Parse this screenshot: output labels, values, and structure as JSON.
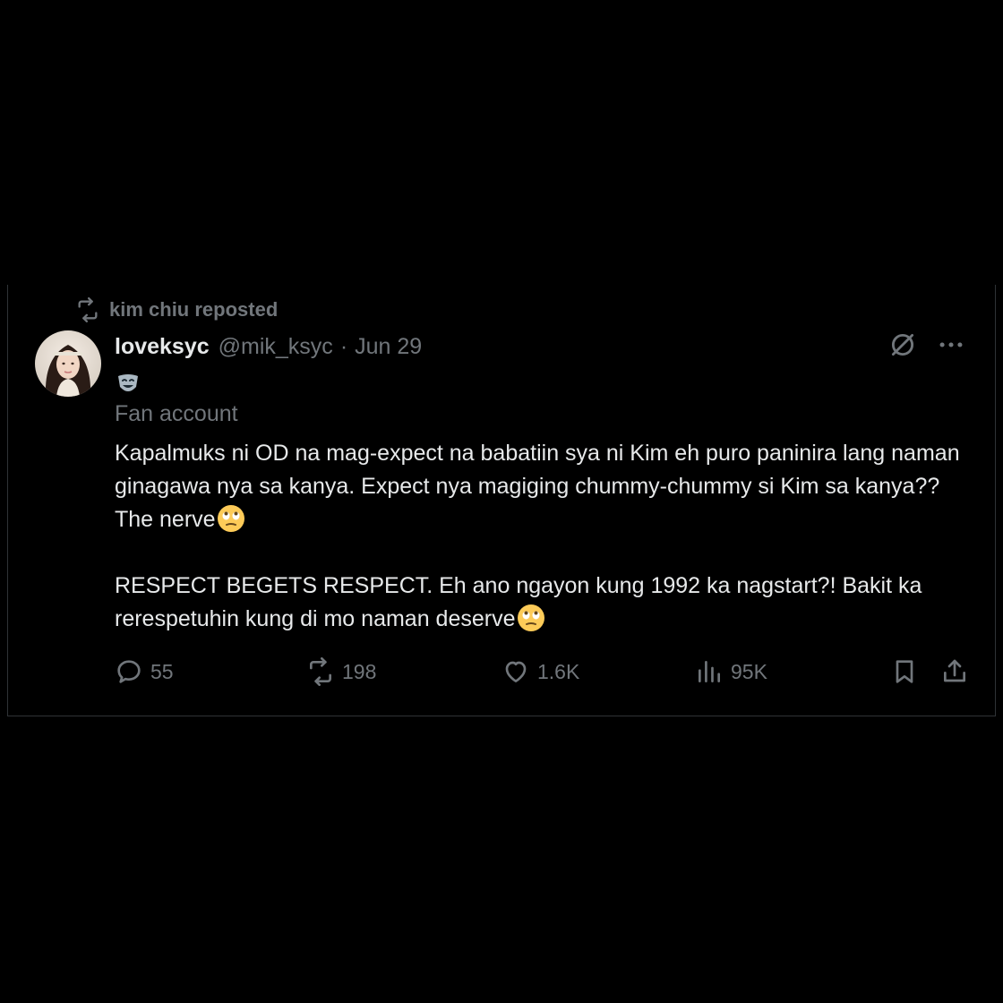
{
  "repost": {
    "text": "kim chiu reposted",
    "icon": "repost-icon"
  },
  "author": {
    "display_name": "loveksyc",
    "handle": "@mik_ksyc",
    "separator": "·",
    "date": "Jun 29",
    "badge_emoji": "performing-arts-mask-emoji",
    "label": "Fan account"
  },
  "tweet": {
    "paragraph1": "Kapalmuks ni OD na mag-expect na babatiin sya ni Kim eh puro paninira lang naman ginagawa nya sa kanya. Expect nya magiging chummy-chummy si Kim sa kanya?? The nerve",
    "paragraph2": "RESPECT BEGETS RESPECT. Eh ano ngayon kung 1992 ka nagstart?! Bakit ka rerespetuhin kung di mo naman deserve",
    "trailing_emoji": "face-with-rolling-eyes-emoji"
  },
  "actions": {
    "replies": "55",
    "reposts": "198",
    "likes": "1.6K",
    "views": "95K"
  },
  "icons": {
    "top_right": [
      "grok-icon",
      "more-icon"
    ],
    "actions": [
      "reply-icon",
      "repost-icon",
      "like-icon",
      "views-icon",
      "bookmark-icon",
      "share-icon"
    ]
  },
  "colors": {
    "background": "#000000",
    "text_primary": "#e7e9ea",
    "text_secondary": "#71767b",
    "border": "#2f3336"
  }
}
